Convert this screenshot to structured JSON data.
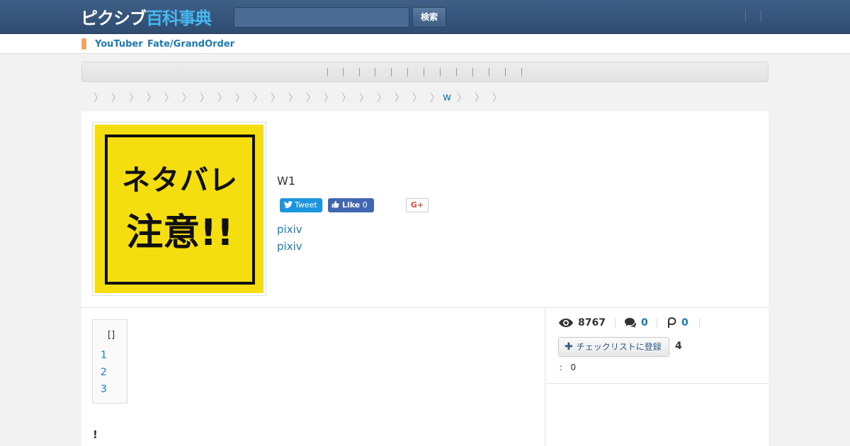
{
  "header": {
    "logo_white": "ピクシブ",
    "logo_blue": "百科事典",
    "search_placeholder": "",
    "search_button": "検索"
  },
  "tagnav": {
    "tags": [
      "YouTuber",
      "Fate/GrandOrder"
    ],
    "marker_color": "#f7a550"
  },
  "breadcrumb": {
    "link": "w"
  },
  "article": {
    "thumb_line1": "ネタバレ",
    "thumb_line2": "注意!!",
    "title": "W1",
    "tweet_label": "Tweet",
    "like_label": "Like",
    "like_count": "0",
    "gplus_label": "G+",
    "links": [
      "pixiv",
      "pixiv"
    ]
  },
  "toc": {
    "title": "[]",
    "items": [
      "1",
      "2",
      "3"
    ]
  },
  "body": {
    "first_line": "!"
  },
  "stats": {
    "views": "8767",
    "comments": "0",
    "pixiv_count": "0",
    "checklist_label": "チェックリストに登録",
    "checklist_count": "4",
    "meta_sep": ":",
    "meta_value": "0"
  },
  "colors": {
    "header": "#34537a",
    "link": "#1a7ab5",
    "logo_accent": "#46b7ef"
  }
}
